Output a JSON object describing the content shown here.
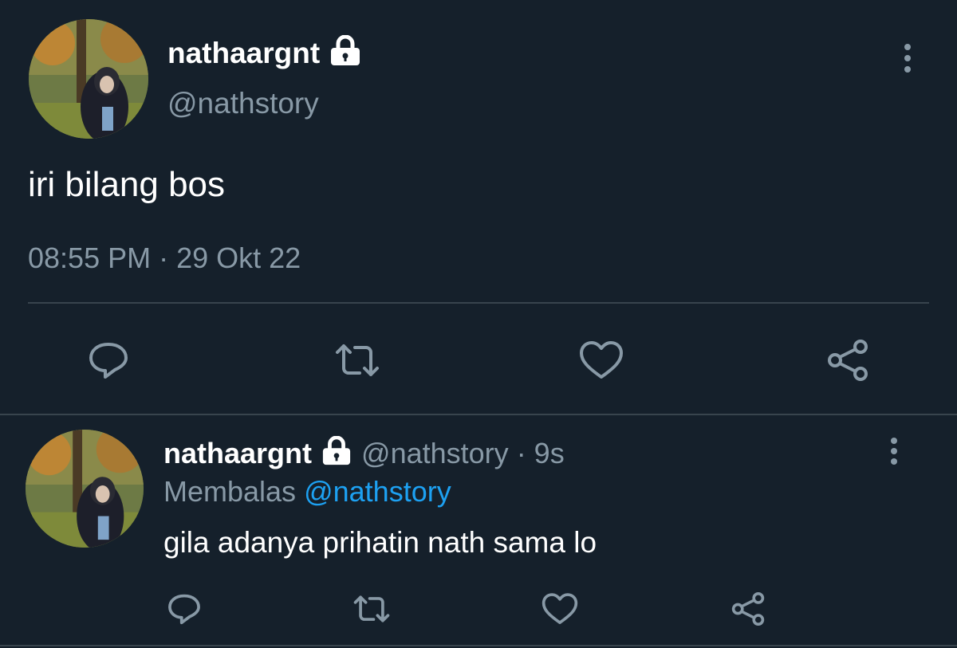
{
  "main_tweet": {
    "display_name": "nathaargnt",
    "handle": "@nathstory",
    "text": "iri bilang bos",
    "timestamp": "08:55 PM · 29 Okt 22",
    "locked_icon": "lock-icon",
    "actions": [
      "reply-icon",
      "retweet-icon",
      "like-icon",
      "share-icon"
    ]
  },
  "reply_tweet": {
    "display_name": "nathaargnt",
    "handle": "@nathstory",
    "time_sep": "· 9s",
    "replying_prefix": "Membalas",
    "replying_handle": "@nathstory",
    "text": "gila adanya prihatin nath sama lo",
    "locked_icon": "lock-icon",
    "actions": [
      "reply-icon",
      "retweet-icon",
      "like-icon",
      "share-icon"
    ]
  },
  "colors": {
    "background": "#15202b",
    "text": "#ffffff",
    "muted": "#8899a6",
    "accent": "#1da1f2",
    "divider": "#38444d"
  }
}
